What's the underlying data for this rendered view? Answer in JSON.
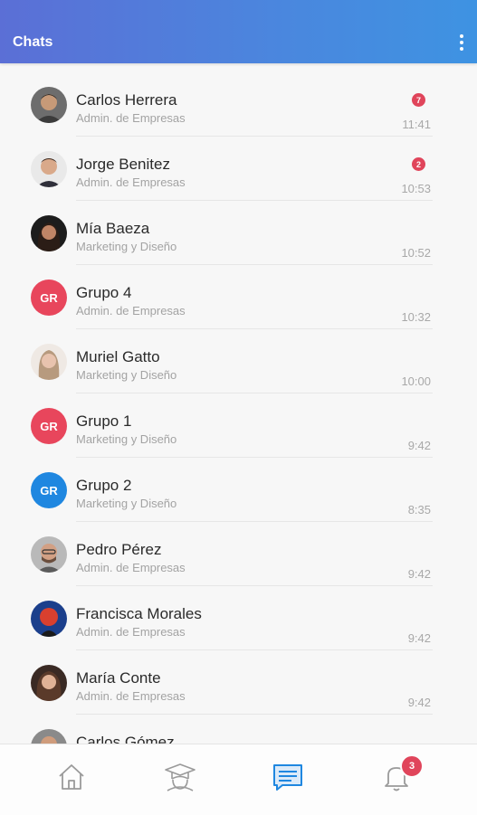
{
  "header": {
    "title": "Chats",
    "menu_icon": "more-vert-icon"
  },
  "colors": {
    "badge": "#e0455b",
    "accent": "#3e93e2",
    "group_red": "#e8465c",
    "group_blue": "#1f87e0"
  },
  "chats": [
    {
      "name": "Carlos Herrera",
      "subtitle": "Admin. de Empresas",
      "time": "11:41",
      "unread": "7",
      "avatar": "photo"
    },
    {
      "name": "Jorge Benitez",
      "subtitle": "Admin. de Empresas",
      "time": "10:53",
      "unread": "2",
      "avatar": "photo"
    },
    {
      "name": "Mía Baeza",
      "subtitle": "Marketing y Diseño",
      "time": "10:52",
      "unread": "",
      "avatar": "photo"
    },
    {
      "name": "Grupo 4",
      "subtitle": "Admin. de Empresas",
      "time": "10:32",
      "unread": "",
      "avatar": "GR"
    },
    {
      "name": "Muriel Gatto",
      "subtitle": "Marketing y Diseño",
      "time": "10:00",
      "unread": "",
      "avatar": "photo"
    },
    {
      "name": "Grupo 1",
      "subtitle": "Marketing y Diseño",
      "time": "9:42",
      "unread": "",
      "avatar": "GR"
    },
    {
      "name": "Grupo 2",
      "subtitle": "Marketing y Diseño",
      "time": "8:35",
      "unread": "",
      "avatar": "GR"
    },
    {
      "name": "Pedro Pérez",
      "subtitle": "Admin. de Empresas",
      "time": "9:42",
      "unread": "",
      "avatar": "photo"
    },
    {
      "name": "Francisca Morales",
      "subtitle": "Admin. de Empresas",
      "time": "9:42",
      "unread": "",
      "avatar": "photo"
    },
    {
      "name": "María Conte",
      "subtitle": "Admin. de Empresas",
      "time": "9:42",
      "unread": "",
      "avatar": "photo"
    },
    {
      "name": "Carlos Gómez",
      "subtitle": "",
      "time": "",
      "unread": "",
      "avatar": "photo"
    }
  ],
  "bottom_nav": {
    "items": [
      {
        "icon": "home-icon"
      },
      {
        "icon": "graduation-cap-icon"
      },
      {
        "icon": "chat-icon",
        "active": true
      },
      {
        "icon": "bell-icon",
        "badge": "3"
      }
    ]
  }
}
